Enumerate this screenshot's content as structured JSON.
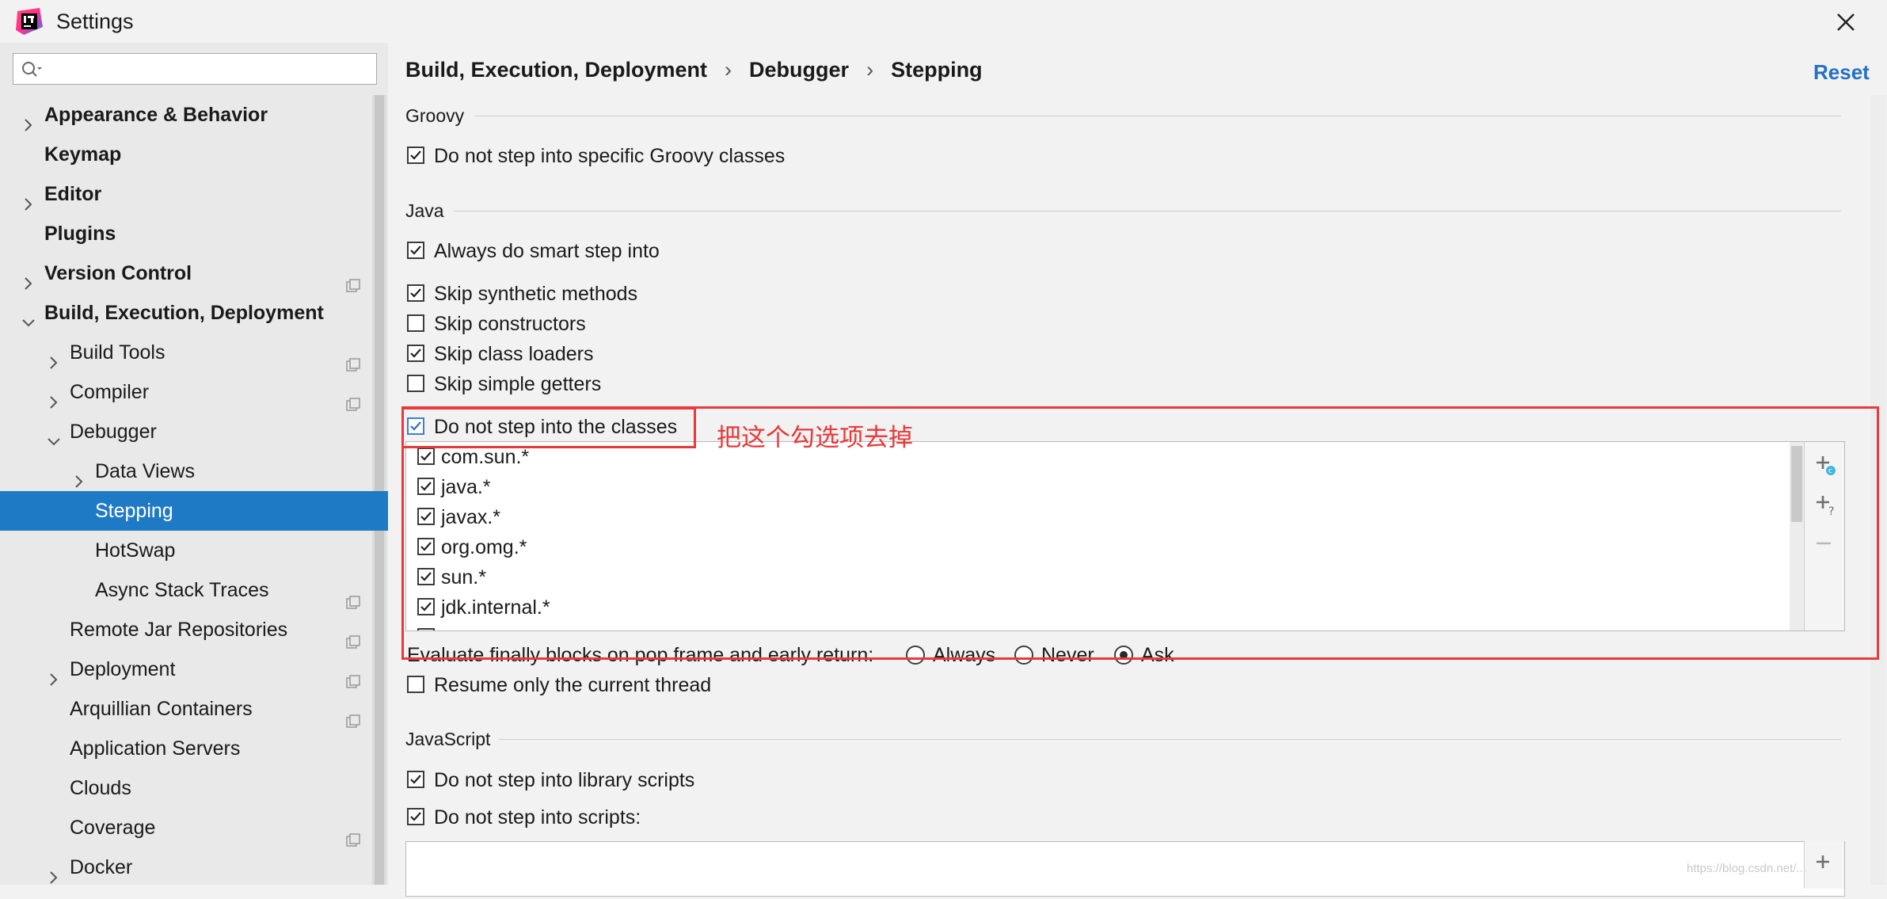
{
  "window": {
    "title": "Settings"
  },
  "search": {
    "placeholder": ""
  },
  "sidebar": {
    "items": [
      {
        "label": "Appearance & Behavior"
      },
      {
        "label": "Keymap"
      },
      {
        "label": "Editor"
      },
      {
        "label": "Plugins"
      },
      {
        "label": "Version Control"
      },
      {
        "label": "Build, Execution, Deployment"
      },
      {
        "label": "Build Tools"
      },
      {
        "label": "Compiler"
      },
      {
        "label": "Debugger"
      },
      {
        "label": "Data Views"
      },
      {
        "label": "Stepping"
      },
      {
        "label": "HotSwap"
      },
      {
        "label": "Async Stack Traces"
      },
      {
        "label": "Remote Jar Repositories"
      },
      {
        "label": "Deployment"
      },
      {
        "label": "Arquillian Containers"
      },
      {
        "label": "Application Servers"
      },
      {
        "label": "Clouds"
      },
      {
        "label": "Coverage"
      },
      {
        "label": "Docker"
      }
    ]
  },
  "breadcrumb": [
    "Build, Execution, Deployment",
    "Debugger",
    "Stepping"
  ],
  "reset_label": "Reset",
  "groovy": {
    "title": "Groovy",
    "options": [
      {
        "label": "Do not step into specific Groovy classes",
        "checked": true
      }
    ]
  },
  "java": {
    "title": "Java",
    "options": [
      {
        "label": "Always do smart step into",
        "checked": true
      },
      {
        "label": "Skip synthetic methods",
        "checked": true
      },
      {
        "label": "Skip constructors",
        "checked": false
      },
      {
        "label": "Skip class loaders",
        "checked": true
      },
      {
        "label": "Skip simple getters",
        "checked": false
      },
      {
        "label": "Do not step into the classes",
        "checked": true
      }
    ],
    "class_filters": [
      {
        "pattern": "com.sun.*",
        "checked": true
      },
      {
        "pattern": "java.*",
        "checked": true
      },
      {
        "pattern": "javax.*",
        "checked": true
      },
      {
        "pattern": "org.omg.*",
        "checked": true
      },
      {
        "pattern": "sun.*",
        "checked": true
      },
      {
        "pattern": "jdk.internal.*",
        "checked": true
      }
    ],
    "eval_label": "Evaluate finally blocks on pop frame and early return:",
    "eval_options": [
      {
        "label": "Always",
        "selected": false
      },
      {
        "label": "Never",
        "selected": false
      },
      {
        "label": "Ask",
        "selected": true
      }
    ],
    "resume_label": "Resume only the current thread",
    "resume_checked": false
  },
  "javascript": {
    "title": "JavaScript",
    "options": [
      {
        "label": "Do not step into library scripts",
        "checked": true
      },
      {
        "label": "Do not step into scripts:",
        "checked": true
      }
    ]
  },
  "annotation": {
    "text": "把这个勾选项去掉",
    "color": "#e8393b"
  },
  "watermark": "https://blog.csdn.net/...",
  "colors": {
    "selection": "#1f7ac5",
    "link": "#2471c4"
  }
}
